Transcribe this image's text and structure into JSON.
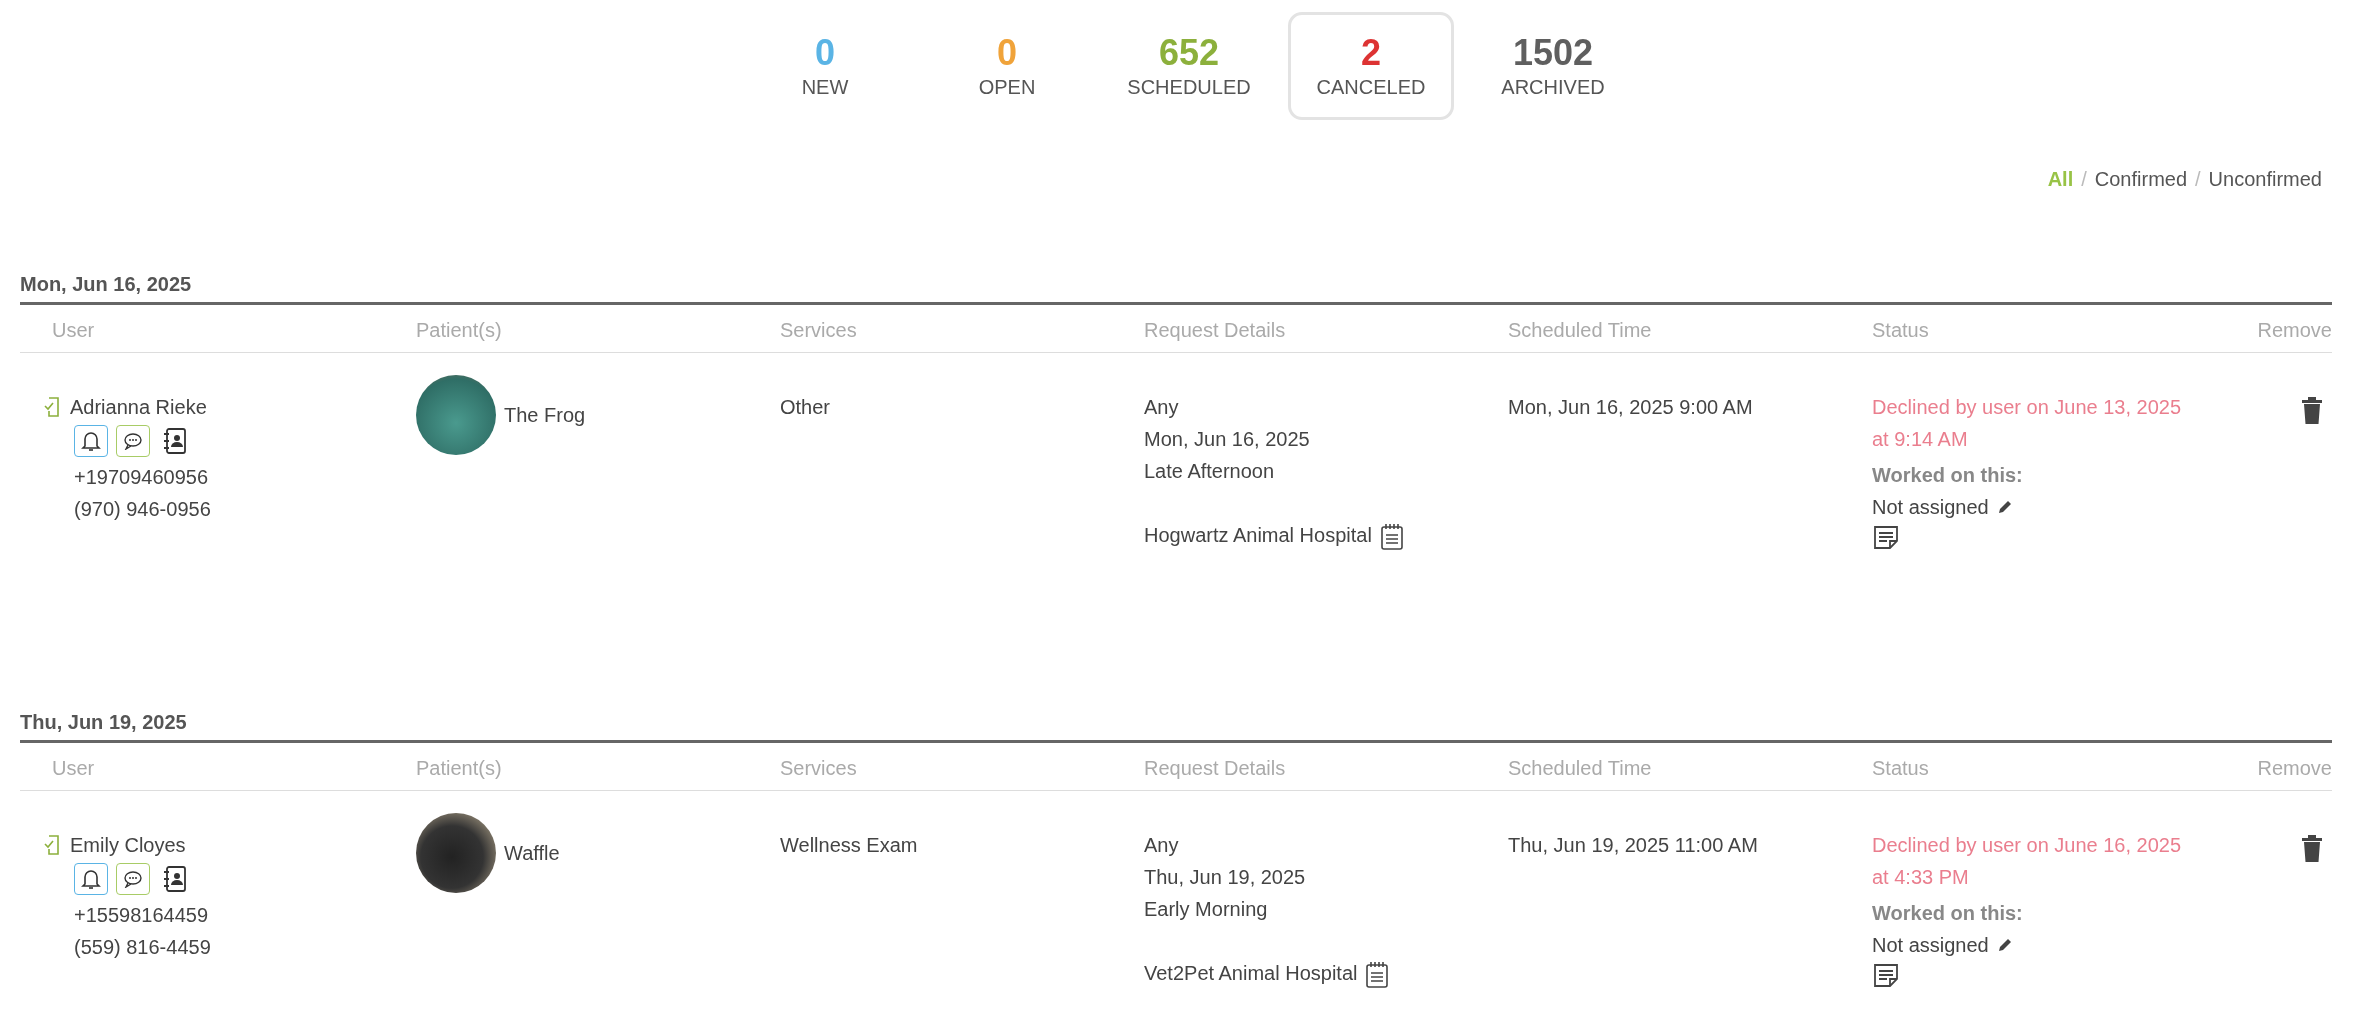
{
  "tabs": [
    {
      "count": "0",
      "label": "NEW",
      "color": "#5ab4e5",
      "selected": false
    },
    {
      "count": "0",
      "label": "OPEN",
      "color": "#f0a33a",
      "selected": false
    },
    {
      "count": "652",
      "label": "SCHEDULED",
      "color": "#8cb03c",
      "selected": false
    },
    {
      "count": "2",
      "label": "CANCELED",
      "color": "#dd3333",
      "selected": true
    },
    {
      "count": "1502",
      "label": "ARCHIVED",
      "color": "#5f5f5f",
      "selected": false
    }
  ],
  "filters": {
    "separator": "/",
    "items": [
      {
        "label": "All",
        "selected": true
      },
      {
        "label": "Confirmed",
        "selected": false
      },
      {
        "label": "Unconfirmed",
        "selected": false
      }
    ]
  },
  "groups": [
    {
      "date": "Mon, Jun 16, 2025",
      "columns": [
        "User",
        "Patient(s)",
        "Services",
        "Request Details",
        "Scheduled Time",
        "Status",
        "Remove"
      ],
      "rows": [
        {
          "user": "Adrianna Rieke",
          "phones": [
            "+19709460956",
            "(970) 946-0956"
          ],
          "patient": "The Frog",
          "service": "Other",
          "request_details": [
            "Any",
            "Mon, Jun 16, 2025",
            "Late Afternoon"
          ],
          "hospital": "Hogwartz Animal Hospital",
          "scheduled_time": "Mon, Jun 16, 2025 9:00 AM",
          "status": "Declined by user on June 13, 2025 at 9:14 AM",
          "worked_on_label": "Worked on this:",
          "assignee": "Not assigned"
        }
      ]
    },
    {
      "date": "Thu, Jun 19, 2025",
      "columns": [
        "User",
        "Patient(s)",
        "Services",
        "Request Details",
        "Scheduled Time",
        "Status",
        "Remove"
      ],
      "rows": [
        {
          "user": "Emily Cloyes",
          "phones": [
            "+15598164459",
            "(559) 816-4459"
          ],
          "patient": "Waffle",
          "service": "Wellness Exam",
          "request_details": [
            "Any",
            "Thu, Jun 19, 2025",
            "Early Morning"
          ],
          "hospital": "Vet2Pet Animal Hospital",
          "scheduled_time": "Thu, Jun 19, 2025 11:00 AM",
          "status": "Declined by user on June 16, 2025 at 4:33 PM",
          "worked_on_label": "Worked on this:",
          "assignee": "Not assigned"
        }
      ]
    }
  ]
}
